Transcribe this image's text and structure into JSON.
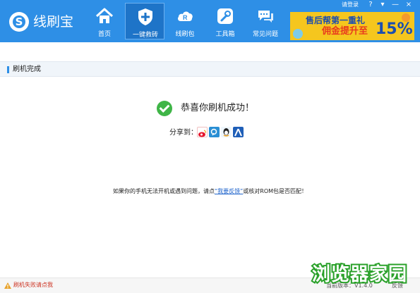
{
  "app": {
    "name": "线刷宝",
    "login": "请登录"
  },
  "window_controls": {
    "help": "?",
    "skin": "▾",
    "minimize": "—",
    "close": "×"
  },
  "nav": [
    {
      "label": "首页",
      "icon": "home-icon"
    },
    {
      "label": "一键救砖",
      "icon": "shield-plus-icon",
      "active": true
    },
    {
      "label": "线刷包",
      "icon": "cloud-rom-icon"
    },
    {
      "label": "工具箱",
      "icon": "wrench-icon"
    },
    {
      "label": "常见问题",
      "icon": "chat-bubbles-icon"
    }
  ],
  "banner": {
    "line1": "售后帮第一重礼",
    "line2": "佣金提升至",
    "percent": "15%"
  },
  "section": {
    "title": "刷机完成"
  },
  "result": {
    "message": "恭喜你刷机成功！",
    "share_label": "分享到："
  },
  "share_targets": [
    {
      "name": "weibo-icon",
      "color": "#e6162d"
    },
    {
      "name": "tencent-weibo-icon",
      "color": "#2a8fd4"
    },
    {
      "name": "qq-icon",
      "color": "#1b9be0"
    },
    {
      "name": "renren-icon",
      "color": "#1f5fb8"
    }
  ],
  "hint": {
    "before": "如果你的手机无法开机或遇到问题，请点",
    "link": "“我要反馈”",
    "after": "或核对ROM包是否匹配！"
  },
  "footer": {
    "fail_text": "刷机失败请点我",
    "version": "当前版本：V1.4.0",
    "feedback": "反馈"
  },
  "watermark": {
    "text": "浏览器家园"
  }
}
